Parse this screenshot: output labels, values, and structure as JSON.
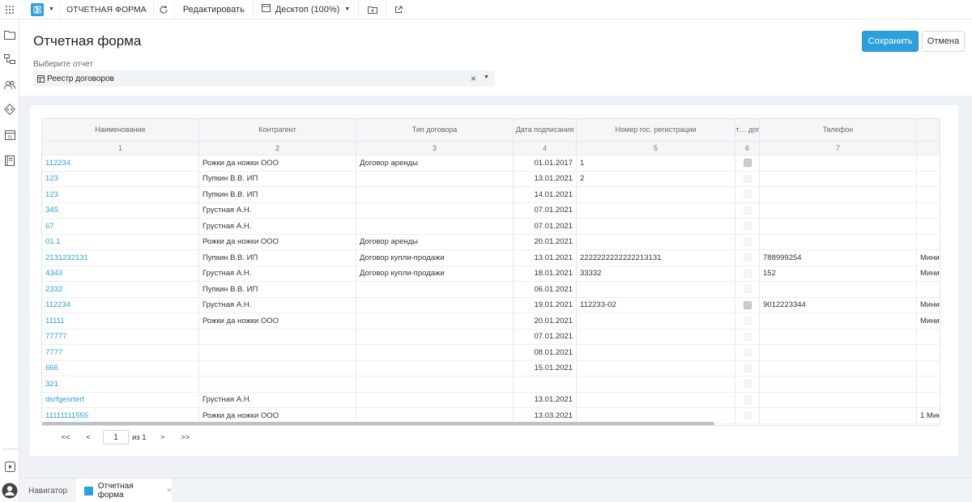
{
  "toolbar": {
    "form_label": "ОТЧЕТНАЯ ФОРМА",
    "edit_label": "Редактировать",
    "view_label": "Десктоп (100%)"
  },
  "header": {
    "title": "Отчетная форма",
    "save_label": "Сохранить",
    "cancel_label": "Отмена",
    "select_label": "Выберите отчет",
    "select_value": "Реестр договоров"
  },
  "table": {
    "columns": [
      {
        "title": "Наименование",
        "num": "1"
      },
      {
        "title": "Контрагент",
        "num": "2"
      },
      {
        "title": "Тип договора",
        "num": "3"
      },
      {
        "title": "Дата подписания",
        "num": "4"
      },
      {
        "title": "Номер гос. регистрации",
        "num": "5"
      },
      {
        "title": "Акт… дог…",
        "num": "6"
      },
      {
        "title": "Телефон",
        "num": "7"
      },
      {
        "title": "",
        "num": ""
      }
    ],
    "rows": [
      {
        "name": "112234",
        "contractor": "Рожки да ножки ООО",
        "type": "Договор аренды",
        "date": "01.01.2017",
        "reg": "1",
        "active": true,
        "phone": "",
        "extra": ""
      },
      {
        "name": "123",
        "contractor": "Пупкин В.В. ИП",
        "type": "",
        "date": "13.01.2021",
        "reg": "2",
        "active": false,
        "phone": "",
        "extra": ""
      },
      {
        "name": "123",
        "contractor": "Пупкин В.В. ИП",
        "type": "",
        "date": "14.01.2021",
        "reg": "",
        "active": false,
        "phone": "",
        "extra": ""
      },
      {
        "name": "345",
        "contractor": "Грустная А.Н.",
        "type": "",
        "date": "07.01.2021",
        "reg": "",
        "active": false,
        "phone": "",
        "extra": ""
      },
      {
        "name": "67",
        "contractor": "Грустная А.Н.",
        "type": "",
        "date": "07.01.2021",
        "reg": "",
        "active": false,
        "phone": "",
        "extra": ""
      },
      {
        "name": "01.1",
        "contractor": "Рожки да ножки ООО",
        "type": "Договор аренды",
        "date": "20.01.2021",
        "reg": "",
        "active": false,
        "phone": "",
        "extra": ""
      },
      {
        "name": "2131232131",
        "contractor": "Пупкин В.В. ИП",
        "type": "Договор купли-продажи",
        "date": "13.01.2021",
        "reg": "2222222222222213131",
        "active": false,
        "phone": "788999254",
        "extra": "Мини"
      },
      {
        "name": "4343",
        "contractor": "Грустная А.Н.",
        "type": "Договор купли-продажи",
        "date": "18.01.2021",
        "reg": "33332",
        "active": false,
        "phone": "152",
        "extra": "Мини"
      },
      {
        "name": "2332",
        "contractor": "Пупкин В.В. ИП",
        "type": "",
        "date": "06.01.2021",
        "reg": "",
        "active": false,
        "phone": "",
        "extra": ""
      },
      {
        "name": "112234",
        "contractor": "Грустная А.Н.",
        "type": "",
        "date": "19.01.2021",
        "reg": "112233-02",
        "active": true,
        "phone": "9012223344",
        "extra": "Мини"
      },
      {
        "name": "11111",
        "contractor": "Рожки да ножки ООО",
        "type": "",
        "date": "20.01.2021",
        "reg": "",
        "active": false,
        "phone": "",
        "extra": "Мини"
      },
      {
        "name": "77777",
        "contractor": "",
        "type": "",
        "date": "07.01.2021",
        "reg": "",
        "active": false,
        "phone": "",
        "extra": ""
      },
      {
        "name": "7777",
        "contractor": "",
        "type": "",
        "date": "08.01.2021",
        "reg": "",
        "active": false,
        "phone": "",
        "extra": ""
      },
      {
        "name": "666",
        "contractor": "",
        "type": "",
        "date": "15.01.2021",
        "reg": "",
        "active": false,
        "phone": "",
        "extra": ""
      },
      {
        "name": "321",
        "contractor": "",
        "type": "",
        "date": "",
        "reg": "",
        "active": false,
        "phone": "",
        "extra": ""
      },
      {
        "name": "dsrfgesrtert",
        "contractor": "Грустная А.Н.",
        "type": "",
        "date": "13.01.2021",
        "reg": "",
        "active": false,
        "phone": "",
        "extra": ""
      },
      {
        "name": "11111111555",
        "contractor": "Рожки да ножки ООО",
        "type": "",
        "date": "13.03.2021",
        "reg": "",
        "active": false,
        "phone": "",
        "extra": "1 Мин"
      }
    ]
  },
  "pager": {
    "first": "<<",
    "prev": "<",
    "page": "1",
    "of": "из 1",
    "next": ">",
    "last": ">>"
  },
  "bottom_tabs": {
    "navigator": "Навигатор",
    "active_tab": "Отчетная форма"
  }
}
